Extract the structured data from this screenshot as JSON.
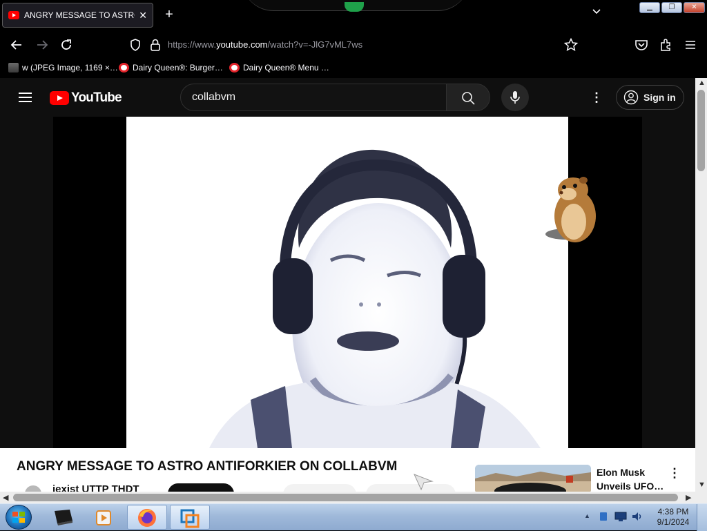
{
  "browser": {
    "tab_title": "ANGRY MESSAGE TO ASTRO AN",
    "tab_close": "✕",
    "new_tab": "+",
    "tab_list": "⌄",
    "url_prefix": "https://www.",
    "url_host": "youtube.com",
    "url_path": "/watch?v=-JlG7vML7ws",
    "bookmarks": [
      {
        "label": "w (JPEG Image, 1169 ×…"
      },
      {
        "label": "Dairy Queen®: Burger…"
      },
      {
        "label": "Dairy Queen® Menu …"
      }
    ]
  },
  "youtube": {
    "logo_text": "YouTube",
    "search_value": "collabvm",
    "sign_in": "Sign in",
    "video_title": "ANGRY MESSAGE TO ASTRO ANTIFORKIER ON COLLABVM",
    "channel_name": "iexist UTTP THDT",
    "recommended": {
      "title": "Elon Musk Unveils UFO…"
    }
  },
  "taskbar": {
    "time": "4:38 PM",
    "date": "9/1/2024"
  },
  "colors": {
    "youtube_red": "#ff0000",
    "page_bg": "#0f0f0f",
    "taskbar": "#9fb9da"
  }
}
